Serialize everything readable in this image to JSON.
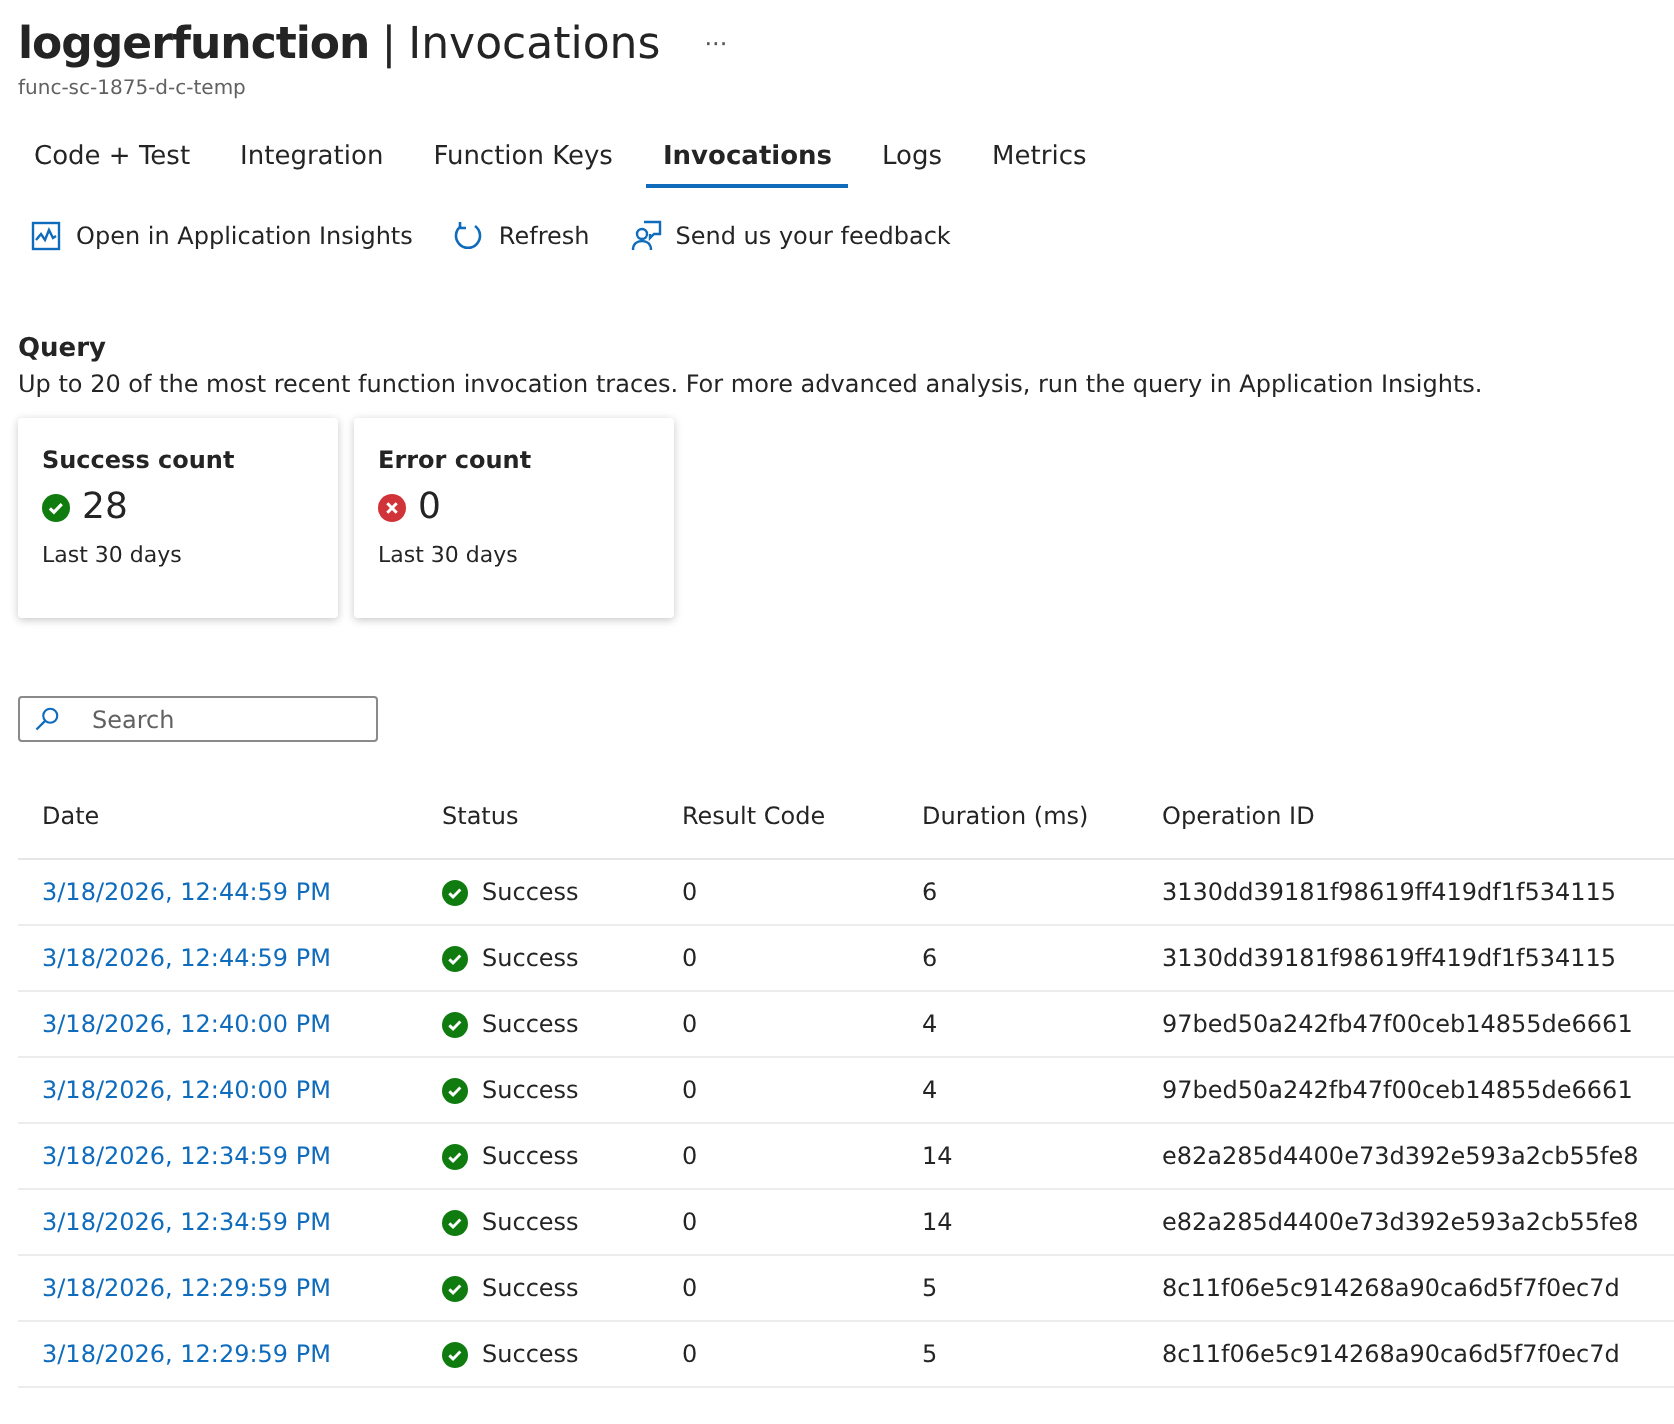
{
  "header": {
    "title": "loggerfunction",
    "separator": "|",
    "section": "Invocations",
    "more": "···",
    "subtitle": "func-sc-1875-d-c-temp"
  },
  "tabs": [
    {
      "label": "Code + Test",
      "selected": false
    },
    {
      "label": "Integration",
      "selected": false
    },
    {
      "label": "Function Keys",
      "selected": false
    },
    {
      "label": "Invocations",
      "selected": true
    },
    {
      "label": "Logs",
      "selected": false
    },
    {
      "label": "Metrics",
      "selected": false
    }
  ],
  "toolbar": [
    {
      "kind": "insights",
      "label": "Open in Application Insights"
    },
    {
      "kind": "refresh",
      "label": "Refresh"
    },
    {
      "kind": "feedback",
      "label": "Send us your feedback"
    }
  ],
  "query": {
    "heading": "Query",
    "description": "Up to 20 of the most recent function invocation traces. For more advanced analysis, run the query in Application Insights."
  },
  "cards": [
    {
      "kind": "success",
      "title": "Success count",
      "value": "28",
      "period": "Last 30 days"
    },
    {
      "kind": "error",
      "title": "Error count",
      "value": "0",
      "period": "Last 30 days"
    }
  ],
  "search": {
    "placeholder": "Search"
  },
  "table": {
    "columns": [
      "Date",
      "Status",
      "Result Code",
      "Duration (ms)",
      "Operation ID"
    ],
    "rows": [
      {
        "date": "3/18/2026, 12:44:59 PM",
        "kind": "success",
        "status": "Success",
        "result_code": "0",
        "duration": "6",
        "operation_id": "3130dd39181f98619ff419df1f534115"
      },
      {
        "date": "3/18/2026, 12:44:59 PM",
        "kind": "success",
        "status": "Success",
        "result_code": "0",
        "duration": "6",
        "operation_id": "3130dd39181f98619ff419df1f534115"
      },
      {
        "date": "3/18/2026, 12:40:00 PM",
        "kind": "success",
        "status": "Success",
        "result_code": "0",
        "duration": "4",
        "operation_id": "97bed50a242fb47f00ceb14855de6661"
      },
      {
        "date": "3/18/2026, 12:40:00 PM",
        "kind": "success",
        "status": "Success",
        "result_code": "0",
        "duration": "4",
        "operation_id": "97bed50a242fb47f00ceb14855de6661"
      },
      {
        "date": "3/18/2026, 12:34:59 PM",
        "kind": "success",
        "status": "Success",
        "result_code": "0",
        "duration": "14",
        "operation_id": "e82a285d4400e73d392e593a2cb55fe8"
      },
      {
        "date": "3/18/2026, 12:34:59 PM",
        "kind": "success",
        "status": "Success",
        "result_code": "0",
        "duration": "14",
        "operation_id": "e82a285d4400e73d392e593a2cb55fe8"
      },
      {
        "date": "3/18/2026, 12:29:59 PM",
        "kind": "success",
        "status": "Success",
        "result_code": "0",
        "duration": "5",
        "operation_id": "8c11f06e5c914268a90ca6d5f7f0ec7d"
      },
      {
        "date": "3/18/2026, 12:29:59 PM",
        "kind": "success",
        "status": "Success",
        "result_code": "0",
        "duration": "5",
        "operation_id": "8c11f06e5c914268a90ca6d5f7f0ec7d"
      }
    ]
  }
}
